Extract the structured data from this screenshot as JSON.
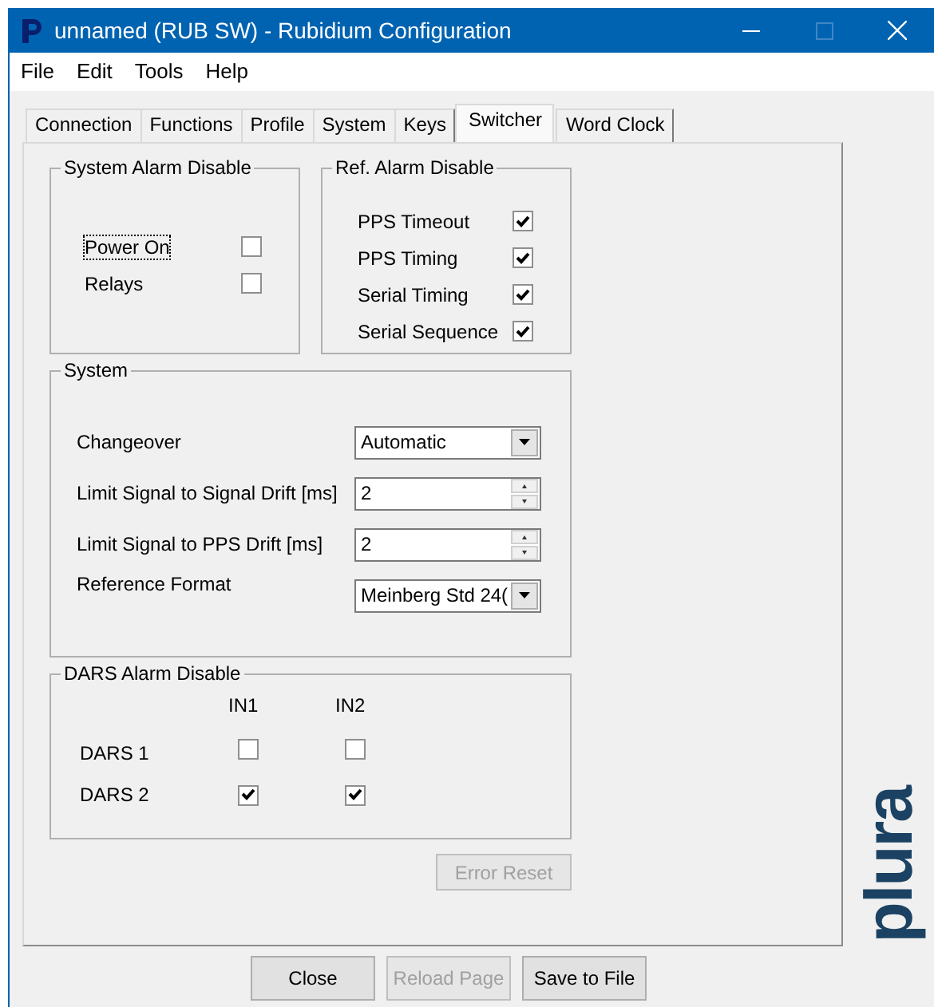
{
  "window": {
    "title": "unnamed (RUB SW) - Rubidium Configuration"
  },
  "menu": [
    "File",
    "Edit",
    "Tools",
    "Help"
  ],
  "tabs": [
    {
      "label": "Connection",
      "selected": false
    },
    {
      "label": "Functions",
      "selected": false
    },
    {
      "label": "Profile",
      "selected": false
    },
    {
      "label": "System",
      "selected": false
    },
    {
      "label": "Keys",
      "selected": false
    },
    {
      "label": "Switcher",
      "selected": true
    },
    {
      "label": "Word Clock",
      "selected": false
    }
  ],
  "system_alarm_disable": {
    "title": "System Alarm Disable",
    "items": [
      {
        "label": "Power On",
        "checked": false,
        "focused": true
      },
      {
        "label": "Relays",
        "checked": false,
        "focused": false
      }
    ]
  },
  "ref_alarm_disable": {
    "title": "Ref. Alarm Disable",
    "items": [
      {
        "label": "PPS Timeout",
        "checked": true,
        "focused": false
      },
      {
        "label": "PPS Timing",
        "checked": true,
        "focused": false
      },
      {
        "label": "Serial Timing",
        "checked": true,
        "focused": false
      },
      {
        "label": "Serial Sequence",
        "checked": true,
        "focused": false
      }
    ]
  },
  "system": {
    "title": "System",
    "fields": [
      {
        "kind": "dropdown",
        "label": "Changeover",
        "value": "Automatic"
      },
      {
        "kind": "spinner",
        "label": "Limit Signal to Signal Drift [ms]",
        "value": "2"
      },
      {
        "kind": "spinner",
        "label": "Limit Signal to PPS Drift [ms]",
        "value": "2"
      },
      {
        "kind": "dropdown",
        "label": "Reference Format",
        "value": "Meinberg Std 24("
      }
    ]
  },
  "dars_alarm_disable": {
    "title": "DARS Alarm Disable",
    "columns": [
      "IN1",
      "IN2"
    ],
    "rows": [
      {
        "label": "DARS 1",
        "checks": [
          false,
          false
        ]
      },
      {
        "label": "DARS 2",
        "checks": [
          true,
          true
        ]
      }
    ]
  },
  "error_reset": {
    "label": "Error Reset",
    "disabled": true
  },
  "buttons": [
    {
      "label": "Close",
      "disabled": false
    },
    {
      "label": "Reload Page",
      "disabled": true
    },
    {
      "label": "Save to File",
      "disabled": false
    }
  ],
  "logo": "plura"
}
